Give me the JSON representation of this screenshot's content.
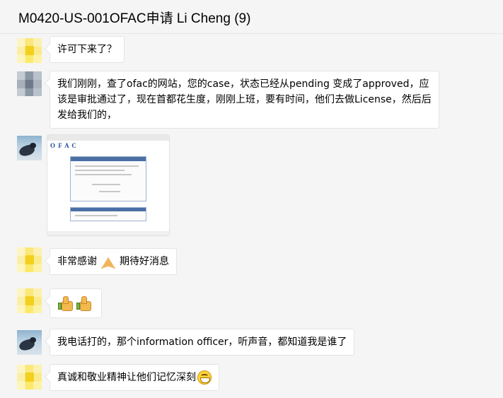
{
  "header": {
    "title": "M0420-US-001OFAC申请 Li Cheng (9)"
  },
  "messages": [
    {
      "sender_avatar": "yellow-avatar",
      "lines": [
        "许可下来了？"
      ]
    },
    {
      "sender_avatar": "gray-avatar",
      "lines": [
        "我们刚刚，查了ofac的网站，您的case，状态已经从pending 变成了approved，应",
        "该是审批通过了，现在首都花生度，刚刚上班，要有时间，他们去做License，然后后",
        "发给我们的，"
      ]
    },
    {
      "sender_avatar": "photo-avatar",
      "image": {
        "logo_text": "O F A C"
      }
    },
    {
      "sender_avatar": "yellow-avatar",
      "text_a": "非常感谢",
      "emoji": "pray-emoji",
      "text_b": "期待好消息"
    },
    {
      "sender_avatar": "yellow-avatar",
      "emojis": [
        "thumbs-up-emoji",
        "thumbs-up-emoji"
      ]
    },
    {
      "sender_avatar": "photo-avatar",
      "lines": [
        "我电话打的，那个information officer，听声音，都知道我是谁了"
      ]
    },
    {
      "sender_avatar": "yellow-avatar",
      "text": "真诚和敬业精神让他们记忆深刻",
      "emoji": "grin-emoji"
    }
  ]
}
